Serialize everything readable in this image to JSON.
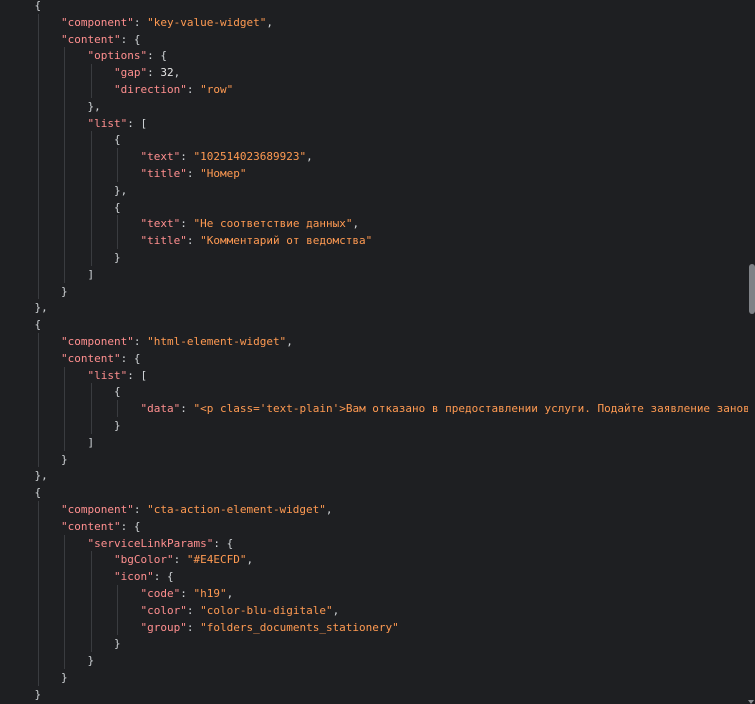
{
  "editor": {
    "lines": [
      {
        "indent": 1,
        "tokens": [
          {
            "t": "p",
            "v": "{"
          }
        ]
      },
      {
        "indent": 2,
        "tokens": [
          {
            "t": "k",
            "v": "\"component\""
          },
          {
            "t": "p",
            "v": ": "
          },
          {
            "t": "s",
            "v": "\"key-value-widget\""
          },
          {
            "t": "p",
            "v": ","
          }
        ]
      },
      {
        "indent": 2,
        "tokens": [
          {
            "t": "k",
            "v": "\"content\""
          },
          {
            "t": "p",
            "v": ": {"
          }
        ]
      },
      {
        "indent": 3,
        "tokens": [
          {
            "t": "k",
            "v": "\"options\""
          },
          {
            "t": "p",
            "v": ": {"
          }
        ]
      },
      {
        "indent": 4,
        "tokens": [
          {
            "t": "k",
            "v": "\"gap\""
          },
          {
            "t": "p",
            "v": ": "
          },
          {
            "t": "n",
            "v": "32"
          },
          {
            "t": "p",
            "v": ","
          }
        ]
      },
      {
        "indent": 4,
        "tokens": [
          {
            "t": "k",
            "v": "\"direction\""
          },
          {
            "t": "p",
            "v": ": "
          },
          {
            "t": "s",
            "v": "\"row\""
          }
        ]
      },
      {
        "indent": 3,
        "tokens": [
          {
            "t": "p",
            "v": "},"
          }
        ]
      },
      {
        "indent": 3,
        "tokens": [
          {
            "t": "k",
            "v": "\"list\""
          },
          {
            "t": "p",
            "v": ": ["
          }
        ]
      },
      {
        "indent": 4,
        "tokens": [
          {
            "t": "p",
            "v": "{"
          }
        ]
      },
      {
        "indent": 5,
        "tokens": [
          {
            "t": "k",
            "v": "\"text\""
          },
          {
            "t": "p",
            "v": ": "
          },
          {
            "t": "s",
            "v": "\"102514023689923\""
          },
          {
            "t": "p",
            "v": ","
          }
        ]
      },
      {
        "indent": 5,
        "tokens": [
          {
            "t": "k",
            "v": "\"title\""
          },
          {
            "t": "p",
            "v": ": "
          },
          {
            "t": "s",
            "v": "\"Номер\""
          }
        ]
      },
      {
        "indent": 4,
        "tokens": [
          {
            "t": "p",
            "v": "},"
          }
        ]
      },
      {
        "indent": 4,
        "tokens": [
          {
            "t": "p",
            "v": "{"
          }
        ]
      },
      {
        "indent": 5,
        "tokens": [
          {
            "t": "k",
            "v": "\"text\""
          },
          {
            "t": "p",
            "v": ": "
          },
          {
            "t": "s",
            "v": "\"Не соответствие данных\""
          },
          {
            "t": "p",
            "v": ","
          }
        ]
      },
      {
        "indent": 5,
        "tokens": [
          {
            "t": "k",
            "v": "\"title\""
          },
          {
            "t": "p",
            "v": ": "
          },
          {
            "t": "s",
            "v": "\"Комментарий от ведомства\""
          }
        ]
      },
      {
        "indent": 4,
        "tokens": [
          {
            "t": "p",
            "v": "}"
          }
        ]
      },
      {
        "indent": 3,
        "tokens": [
          {
            "t": "p",
            "v": "]"
          }
        ]
      },
      {
        "indent": 2,
        "tokens": [
          {
            "t": "p",
            "v": "}"
          }
        ]
      },
      {
        "indent": 1,
        "tokens": [
          {
            "t": "p",
            "v": "},"
          }
        ]
      },
      {
        "indent": 1,
        "tokens": [
          {
            "t": "p",
            "v": "{"
          }
        ]
      },
      {
        "indent": 2,
        "tokens": [
          {
            "t": "k",
            "v": "\"component\""
          },
          {
            "t": "p",
            "v": ": "
          },
          {
            "t": "s",
            "v": "\"html-element-widget\""
          },
          {
            "t": "p",
            "v": ","
          }
        ]
      },
      {
        "indent": 2,
        "tokens": [
          {
            "t": "k",
            "v": "\"content\""
          },
          {
            "t": "p",
            "v": ": {"
          }
        ]
      },
      {
        "indent": 3,
        "tokens": [
          {
            "t": "k",
            "v": "\"list\""
          },
          {
            "t": "p",
            "v": ": ["
          }
        ]
      },
      {
        "indent": 4,
        "tokens": [
          {
            "t": "p",
            "v": "{"
          }
        ]
      },
      {
        "indent": 5,
        "tokens": [
          {
            "t": "k",
            "v": "\"data\""
          },
          {
            "t": "p",
            "v": ": "
          },
          {
            "t": "s",
            "v": "\"<p class='text-plain'>Вам отказано в предоставлении услуги. Подайте заявление занов"
          }
        ]
      },
      {
        "indent": 4,
        "tokens": [
          {
            "t": "p",
            "v": "}"
          }
        ]
      },
      {
        "indent": 3,
        "tokens": [
          {
            "t": "p",
            "v": "]"
          }
        ]
      },
      {
        "indent": 2,
        "tokens": [
          {
            "t": "p",
            "v": "}"
          }
        ]
      },
      {
        "indent": 1,
        "tokens": [
          {
            "t": "p",
            "v": "},"
          }
        ]
      },
      {
        "indent": 1,
        "tokens": [
          {
            "t": "p",
            "v": "{"
          }
        ]
      },
      {
        "indent": 2,
        "tokens": [
          {
            "t": "k",
            "v": "\"component\""
          },
          {
            "t": "p",
            "v": ": "
          },
          {
            "t": "s",
            "v": "\"cta-action-element-widget\""
          },
          {
            "t": "p",
            "v": ","
          }
        ]
      },
      {
        "indent": 2,
        "tokens": [
          {
            "t": "k",
            "v": "\"content\""
          },
          {
            "t": "p",
            "v": ": {"
          }
        ]
      },
      {
        "indent": 3,
        "tokens": [
          {
            "t": "k",
            "v": "\"serviceLinkParams\""
          },
          {
            "t": "p",
            "v": ": {"
          }
        ]
      },
      {
        "indent": 4,
        "tokens": [
          {
            "t": "k",
            "v": "\"bgColor\""
          },
          {
            "t": "p",
            "v": ": "
          },
          {
            "t": "s",
            "v": "\"#E4ECFD\""
          },
          {
            "t": "p",
            "v": ","
          }
        ]
      },
      {
        "indent": 4,
        "tokens": [
          {
            "t": "k",
            "v": "\"icon\""
          },
          {
            "t": "p",
            "v": ": {"
          }
        ]
      },
      {
        "indent": 5,
        "tokens": [
          {
            "t": "k",
            "v": "\"code\""
          },
          {
            "t": "p",
            "v": ": "
          },
          {
            "t": "s",
            "v": "\"h19\""
          },
          {
            "t": "p",
            "v": ","
          }
        ]
      },
      {
        "indent": 5,
        "tokens": [
          {
            "t": "k",
            "v": "\"color\""
          },
          {
            "t": "p",
            "v": ": "
          },
          {
            "t": "s",
            "v": "\"color-blu-digitale\""
          },
          {
            "t": "p",
            "v": ","
          }
        ]
      },
      {
        "indent": 5,
        "tokens": [
          {
            "t": "k",
            "v": "\"group\""
          },
          {
            "t": "p",
            "v": ": "
          },
          {
            "t": "s",
            "v": "\"folders_documents_stationery\""
          }
        ]
      },
      {
        "indent": 4,
        "tokens": [
          {
            "t": "p",
            "v": "}"
          }
        ]
      },
      {
        "indent": 3,
        "tokens": [
          {
            "t": "p",
            "v": "}"
          }
        ]
      },
      {
        "indent": 2,
        "tokens": [
          {
            "t": "p",
            "v": "}"
          }
        ]
      },
      {
        "indent": 1,
        "tokens": [
          {
            "t": "p",
            "v": "}"
          }
        ]
      }
    ]
  },
  "colors": {
    "background": "#1e1f22",
    "key": "#ff8f8f",
    "string": "#ff9a52",
    "number": "#e6e6e6",
    "punctuation": "#cfd3d6",
    "indent_guide": "#3a3c40",
    "scrollbar_thumb": "#7f8287"
  }
}
